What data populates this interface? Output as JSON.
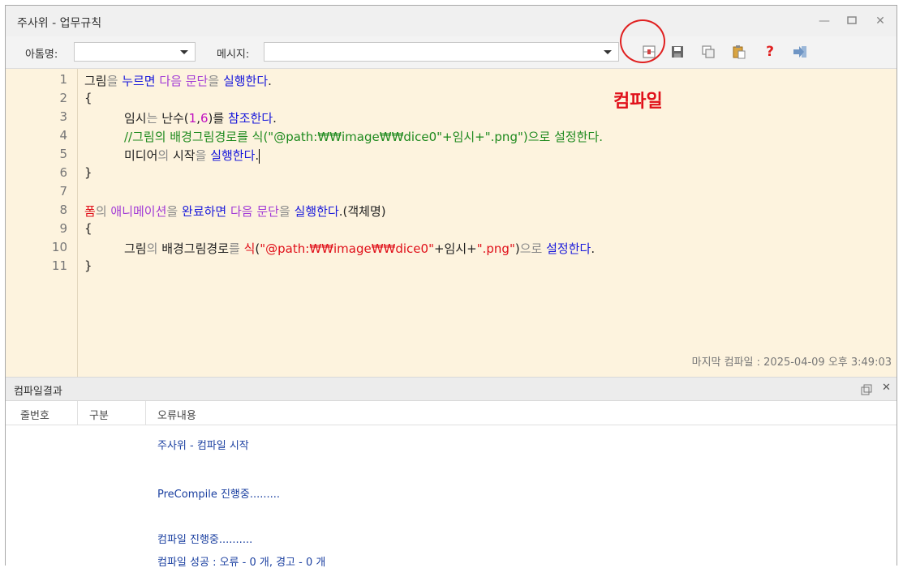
{
  "window": {
    "title": "주사위 - 업무규칙"
  },
  "toolbar": {
    "event_label": "아톰명:",
    "event_value": "",
    "message_label": "메시지:",
    "message_value": ""
  },
  "callout": {
    "text": "컴파일"
  },
  "editor": {
    "line_numbers": [
      "1",
      "2",
      "3",
      "4",
      "5",
      "6",
      "7",
      "8",
      "9",
      "10",
      "11"
    ],
    "lines": [
      "그림을 누르면 다음 문단을 실행한다.",
      "{",
      "임시는 난수(1,6)를 참조한다.",
      "//그림의 배경그림경로를 식(\"@path:₩₩image₩₩dice0\"+임시+\".png\")으로 설정한다.",
      "미디어의 시작을 실행한다.",
      "}",
      "",
      "폼의 애니메이션을 완료하면 다음 문단을 실행한다.(객체명)",
      "{",
      "그림의 배경그림경로를 식(\"@path:₩₩image₩₩dice0\"+임시+\".png\")으로 설정한다.",
      "}"
    ],
    "last_compile": "마지막 컴파일 : 2025-04-09 오후 3:49:03"
  },
  "results": {
    "title": "컴파일결과",
    "columns": [
      "줄번호",
      "구분",
      "오류내용"
    ],
    "lines": [
      "주사위 - 컴파일 시작",
      "PreCompile 진행중.........",
      "컴파일 진행중..........",
      "컴파일 성공 : 오류 - 0 개, 경고 - 0 개"
    ]
  },
  "colors": {
    "editor_bg": "#fdf3de",
    "keyword_blue": "#1a1adb",
    "keyword_purple": "#a23bd6",
    "comment_green": "#1e8a1e",
    "string_red": "#e0101a",
    "callout_red": "#e0101a"
  }
}
